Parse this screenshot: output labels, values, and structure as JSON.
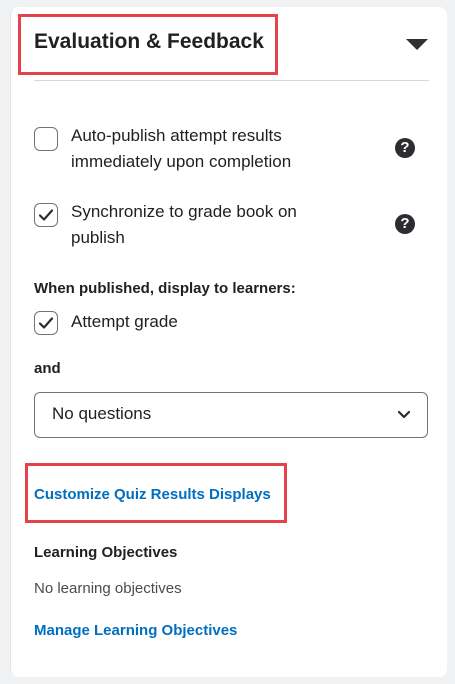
{
  "section": {
    "title": "Evaluation & Feedback",
    "collapse_icon": "caret-down-icon"
  },
  "options": [
    {
      "label": "Auto-publish attempt results immediately upon completion",
      "line1": "Auto-publish attempt results",
      "line2": "immediately upon completion",
      "checked": false,
      "help_icon": "help-icon"
    },
    {
      "label": "Synchronize to grade book on publish",
      "line1": "Synchronize to grade book on",
      "line2": "publish",
      "checked": true,
      "help_icon": "help-icon"
    }
  ],
  "display": {
    "heading": "When published, display to learners:",
    "attempt_grade_label": "Attempt grade",
    "attempt_grade_checked": true,
    "and_label": "and",
    "questions_select_value": "No questions"
  },
  "customize_link": "Customize Quiz Results Displays",
  "learning_objectives": {
    "heading": "Learning Objectives",
    "empty_text": "No learning objectives",
    "manage_link": "Manage Learning Objectives"
  },
  "colors": {
    "link": "#006fbf",
    "highlight": "#e4434c"
  }
}
